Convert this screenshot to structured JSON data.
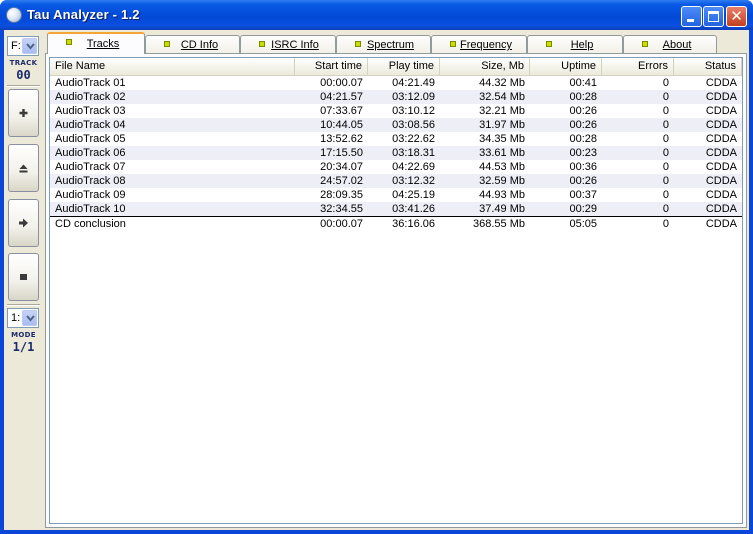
{
  "window": {
    "title": "Tau Analyzer - 1.2",
    "close_glyph": "✕"
  },
  "leftbar": {
    "drive": "F:",
    "track_caption": "TRACK",
    "track_value": "00",
    "buttons": [
      "plus-icon",
      "eject-icon",
      "play-icon",
      "stop-icon"
    ],
    "mode_select": "1:",
    "mode_caption": "MODE",
    "mode_value": "1/1"
  },
  "tabs": [
    {
      "label": "Tracks",
      "active": true
    },
    {
      "label": "CD Info",
      "active": false
    },
    {
      "label": "ISRC Info",
      "active": false
    },
    {
      "label": "Spectrum",
      "active": false
    },
    {
      "label": "Frequency",
      "active": false
    },
    {
      "label": "Help",
      "active": false
    },
    {
      "label": "About",
      "active": false
    }
  ],
  "table": {
    "columns": [
      "File Name",
      "Start time",
      "Play time",
      "Size, Mb",
      "Uptime",
      "Errors",
      "Status"
    ],
    "rows": [
      [
        "AudioTrack 01",
        "00:00.07",
        "04:21.49",
        "44.32 Mb",
        "00:41",
        "0",
        "CDDA"
      ],
      [
        "AudioTrack 02",
        "04:21.57",
        "03:12.09",
        "32.54 Mb",
        "00:28",
        "0",
        "CDDA"
      ],
      [
        "AudioTrack 03",
        "07:33.67",
        "03:10.12",
        "32.21 Mb",
        "00:26",
        "0",
        "CDDA"
      ],
      [
        "AudioTrack 04",
        "10:44.05",
        "03:08.56",
        "31.97 Mb",
        "00:26",
        "0",
        "CDDA"
      ],
      [
        "AudioTrack 05",
        "13:52.62",
        "03:22.62",
        "34.35 Mb",
        "00:28",
        "0",
        "CDDA"
      ],
      [
        "AudioTrack 06",
        "17:15.50",
        "03:18.31",
        "33.61 Mb",
        "00:23",
        "0",
        "CDDA"
      ],
      [
        "AudioTrack 07",
        "20:34.07",
        "04:22.69",
        "44.53 Mb",
        "00:36",
        "0",
        "CDDA"
      ],
      [
        "AudioTrack 08",
        "24:57.02",
        "03:12.32",
        "32.59 Mb",
        "00:26",
        "0",
        "CDDA"
      ],
      [
        "AudioTrack 09",
        "28:09.35",
        "04:25.19",
        "44.93 Mb",
        "00:37",
        "0",
        "CDDA"
      ],
      [
        "AudioTrack 10",
        "32:34.55",
        "03:41.26",
        "37.49 Mb",
        "00:29",
        "0",
        "CDDA"
      ]
    ],
    "summary": [
      "CD conclusion",
      "00:00.07",
      "36:16.06",
      "368.55 Mb",
      "05:05",
      "0",
      "CDDA"
    ]
  },
  "colors": {
    "titlebar": "#0149d6",
    "tab_active_accent": "#f4a533",
    "alt_row": "#eeeff6",
    "tab_indicator": "#c8e000"
  }
}
